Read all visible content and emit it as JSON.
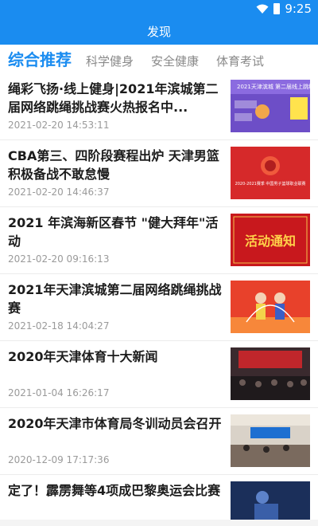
{
  "status": {
    "time": "9:25"
  },
  "header": {
    "title": "发现"
  },
  "tabs": [
    {
      "label": "综合推荐"
    },
    {
      "label": "科学健身"
    },
    {
      "label": "安全健康"
    },
    {
      "label": "体育考试"
    }
  ],
  "articles": [
    {
      "title": "绳彩飞扬·线上健身|2021年滨城第二届网络跳绳挑战赛火热报名中...",
      "time": "2021-02-20 14:53:11",
      "thumb_text": "2021天津滨城 第二届线上跳绳挑战赛"
    },
    {
      "title": "CBA第三、四阶段赛程出炉 天津男篮积极备战不敢怠慢",
      "time": "2021-02-20 14:46:37",
      "thumb_text": "2020-2021赛季 中国男子篮球职业联赛"
    },
    {
      "title": "2021 年滨海新区春节 \"健大拜年\"活动",
      "time": "2021-02-20 09:16:13",
      "thumb_text": "活动通知"
    },
    {
      "title": "2021年天津滨城第二届网络跳绳挑战赛",
      "time": "2021-02-18 14:04:27",
      "thumb_text": ""
    },
    {
      "title": "2020年天津体育十大新闻",
      "time": "2021-01-04 16:26:17",
      "thumb_text": ""
    },
    {
      "title": "2020年天津市体育局冬训动员会召开",
      "time": "2020-12-09 17:17:36",
      "thumb_text": ""
    },
    {
      "title": "定了！霹雳舞等4项成巴黎奥运会比赛",
      "time": "",
      "thumb_text": ""
    }
  ],
  "colors": {
    "primary": "#1a8cf0",
    "inactive_tab": "#8a8a8a",
    "time": "#9a9a9a"
  }
}
